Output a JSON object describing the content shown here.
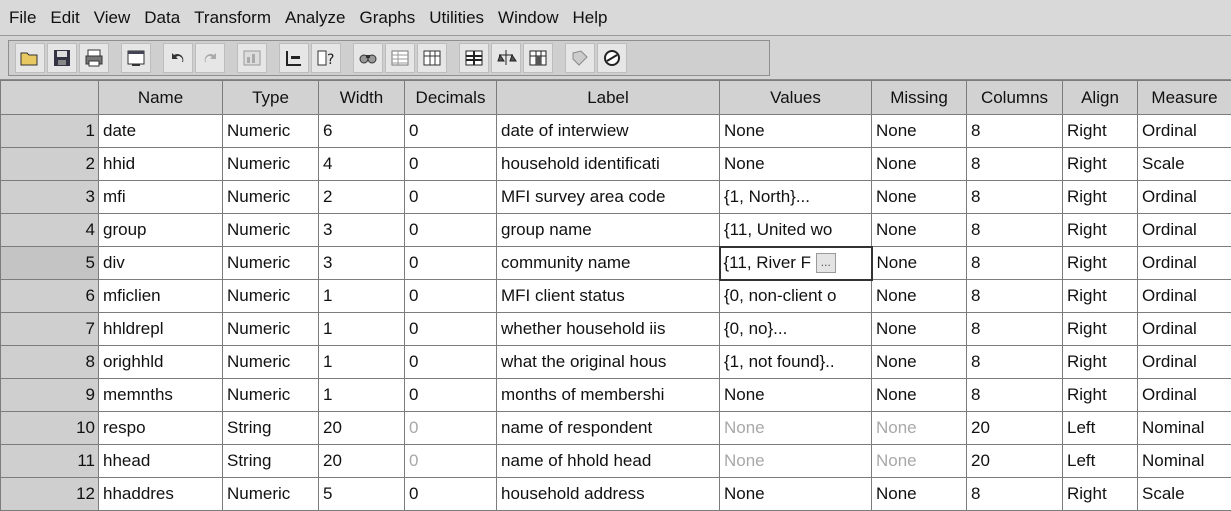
{
  "menu": [
    "File",
    "Edit",
    "View",
    "Data",
    "Transform",
    "Analyze",
    "Graphs",
    "Utilities",
    "Window",
    "Help"
  ],
  "toolbar_icons": [
    "open-icon",
    "save-icon",
    "print-icon",
    "dialog-recall-icon",
    "undo-icon",
    "redo-icon",
    "goto-chart-icon",
    "goto-case-icon",
    "variables-icon",
    "find-icon",
    "insert-case-icon",
    "insert-variable-icon",
    "split-file-icon",
    "weight-cases-icon",
    "select-cases-icon",
    "value-labels-icon",
    "use-sets-icon"
  ],
  "columns": [
    "",
    "Name",
    "Type",
    "Width",
    "Decimals",
    "Label",
    "Values",
    "Missing",
    "Columns",
    "Align",
    "Measure"
  ],
  "rows": [
    {
      "n": "1",
      "name": "date",
      "type": "Numeric",
      "width": "6",
      "dec": "0",
      "label": "date of interwiew",
      "values": "None",
      "missing": "None",
      "cols": "8",
      "align": "Right",
      "measure": "Ordinal"
    },
    {
      "n": "2",
      "name": "hhid",
      "type": "Numeric",
      "width": "4",
      "dec": "0",
      "label": "household identificati",
      "values": "None",
      "missing": "None",
      "cols": "8",
      "align": "Right",
      "measure": "Scale"
    },
    {
      "n": "3",
      "name": "mfi",
      "type": "Numeric",
      "width": "2",
      "dec": "0",
      "label": "MFI survey area code",
      "values": "{1, North}...",
      "missing": "None",
      "cols": "8",
      "align": "Right",
      "measure": "Ordinal"
    },
    {
      "n": "4",
      "name": "group",
      "type": "Numeric",
      "width": "3",
      "dec": "0",
      "label": "group name",
      "values": "{11, United wo",
      "missing": "None",
      "cols": "8",
      "align": "Right",
      "measure": "Ordinal"
    },
    {
      "n": "5",
      "name": "div",
      "type": "Numeric",
      "width": "3",
      "dec": "0",
      "label": "community name",
      "values": "{11, River F",
      "missing": "None",
      "cols": "8",
      "align": "Right",
      "measure": "Ordinal"
    },
    {
      "n": "6",
      "name": "mficlien",
      "type": "Numeric",
      "width": "1",
      "dec": "0",
      "label": "MFI client status",
      "values": "{0, non-client o",
      "missing": "None",
      "cols": "8",
      "align": "Right",
      "measure": "Ordinal"
    },
    {
      "n": "7",
      "name": "hhldrepl",
      "type": "Numeric",
      "width": "1",
      "dec": "0",
      "label": "whether household iis",
      "values": "{0, no}...",
      "missing": "None",
      "cols": "8",
      "align": "Right",
      "measure": "Ordinal"
    },
    {
      "n": "8",
      "name": "orighhld",
      "type": "Numeric",
      "width": "1",
      "dec": "0",
      "label": "what the original hous",
      "values": "{1, not found}..",
      "missing": "None",
      "cols": "8",
      "align": "Right",
      "measure": "Ordinal"
    },
    {
      "n": "9",
      "name": "memnths",
      "type": "Numeric",
      "width": "1",
      "dec": "0",
      "label": "months of membershi",
      "values": "None",
      "missing": "None",
      "cols": "8",
      "align": "Right",
      "measure": "Ordinal"
    },
    {
      "n": "10",
      "name": "respo",
      "type": "String",
      "width": "20",
      "dec": "0",
      "label": "name of respondent",
      "values": "None",
      "missing": "None",
      "cols": "20",
      "align": "Left",
      "measure": "Nominal"
    },
    {
      "n": "11",
      "name": "hhead",
      "type": "String",
      "width": "20",
      "dec": "0",
      "label": "name of hhold head",
      "values": "None",
      "missing": "None",
      "cols": "20",
      "align": "Left",
      "measure": "Nominal"
    },
    {
      "n": "12",
      "name": "hhaddres",
      "type": "Numeric",
      "width": "5",
      "dec": "0",
      "label": "household address",
      "values": "None",
      "missing": "None",
      "cols": "8",
      "align": "Right",
      "measure": "Scale"
    }
  ],
  "active_ellipsis": "..."
}
